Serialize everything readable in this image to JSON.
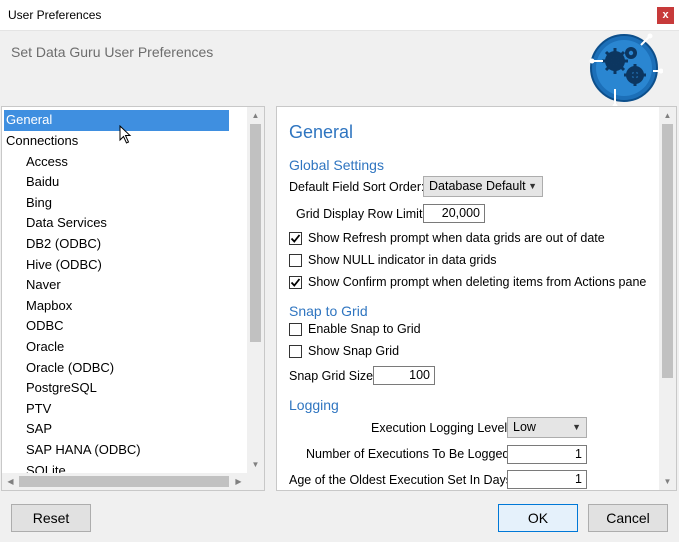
{
  "window": {
    "title": "User Preferences",
    "close_glyph": "x"
  },
  "header": {
    "subtitle": "Set Data Guru User Preferences",
    "logo_icon": "gears-circuit-logo"
  },
  "tree": {
    "items": [
      {
        "label": "General",
        "level": 0,
        "selected": true
      },
      {
        "label": "Connections",
        "level": 0
      },
      {
        "label": "Access",
        "level": 1
      },
      {
        "label": "Baidu",
        "level": 1
      },
      {
        "label": "Bing",
        "level": 1
      },
      {
        "label": "Data Services",
        "level": 1
      },
      {
        "label": "DB2 (ODBC)",
        "level": 1
      },
      {
        "label": "Hive (ODBC)",
        "level": 1
      },
      {
        "label": "Naver",
        "level": 1
      },
      {
        "label": "Mapbox",
        "level": 1
      },
      {
        "label": "ODBC",
        "level": 1
      },
      {
        "label": "Oracle",
        "level": 1
      },
      {
        "label": "Oracle (ODBC)",
        "level": 1
      },
      {
        "label": "PostgreSQL",
        "level": 1
      },
      {
        "label": "PTV",
        "level": 1
      },
      {
        "label": "SAP",
        "level": 1
      },
      {
        "label": "SAP HANA (ODBC)",
        "level": 1
      },
      {
        "label": "SQLite",
        "level": 1
      }
    ]
  },
  "general": {
    "title": "General",
    "global": {
      "title": "Global Settings",
      "sort_order_label": "Default Field Sort Order:",
      "sort_order_value": "Database Default",
      "row_limit_label": "Grid Display Row Limit:",
      "row_limit_value": "20,000",
      "show_refresh": "Show Refresh prompt when data grids are out of date",
      "show_null": "Show NULL indicator in data grids",
      "show_confirm": "Show Confirm prompt when deleting items from Actions pane"
    },
    "snap": {
      "title": "Snap to Grid",
      "enable": "Enable Snap to Grid",
      "show": "Show Snap Grid",
      "size_label": "Snap Grid Size:",
      "size_value": "100"
    },
    "logging": {
      "title": "Logging",
      "level_label": "Execution Logging Level:",
      "level_value": "Low",
      "num_label": "Number of Executions To Be Logged:",
      "num_value": "1",
      "age_label": "Age of the Oldest Execution Set In Days:",
      "age_value": "1"
    }
  },
  "buttons": {
    "reset": "Reset",
    "ok": "OK",
    "cancel": "Cancel"
  },
  "colors": {
    "accent": "#2f75c0",
    "selection": "#3f8fe0",
    "close": "#c73a3a"
  }
}
